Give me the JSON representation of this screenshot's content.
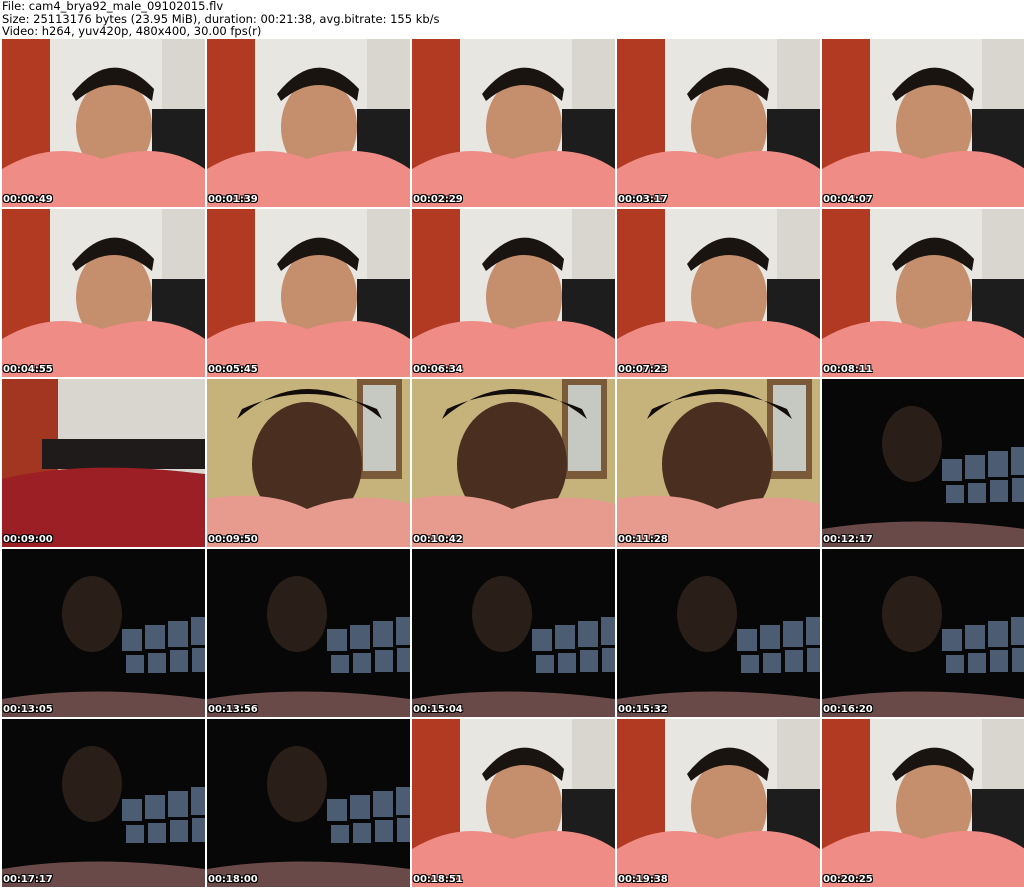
{
  "header": {
    "line1": "File: cam4_brya92_male_09102015.flv",
    "line2": "Size: 25113176 bytes (23.95 MiB), duration: 00:21:38, avg.bitrate: 155 kb/s",
    "line3": "Video: h264, yuv420p, 480x400, 30.00 fps(r)"
  },
  "thumbnails": [
    {
      "time": "00:00:49",
      "scene": "bright"
    },
    {
      "time": "00:01:39",
      "scene": "bright"
    },
    {
      "time": "00:02:29",
      "scene": "bright"
    },
    {
      "time": "00:03:17",
      "scene": "bright"
    },
    {
      "time": "00:04:07",
      "scene": "bright"
    },
    {
      "time": "00:04:55",
      "scene": "bright"
    },
    {
      "time": "00:05:45",
      "scene": "bright"
    },
    {
      "time": "00:06:34",
      "scene": "bright"
    },
    {
      "time": "00:07:23",
      "scene": "bright"
    },
    {
      "time": "00:08:11",
      "scene": "bright"
    },
    {
      "time": "00:09:00",
      "scene": "empty"
    },
    {
      "time": "00:09:50",
      "scene": "yellow"
    },
    {
      "time": "00:10:42",
      "scene": "yellow"
    },
    {
      "time": "00:11:28",
      "scene": "yellow"
    },
    {
      "time": "00:12:17",
      "scene": "dark"
    },
    {
      "time": "00:13:05",
      "scene": "dark"
    },
    {
      "time": "00:13:56",
      "scene": "dark"
    },
    {
      "time": "00:15:04",
      "scene": "dark"
    },
    {
      "time": "00:15:32",
      "scene": "dark"
    },
    {
      "time": "00:16:20",
      "scene": "dark"
    },
    {
      "time": "00:17:17",
      "scene": "dark"
    },
    {
      "time": "00:18:00",
      "scene": "dark"
    },
    {
      "time": "00:18:51",
      "scene": "bright"
    },
    {
      "time": "00:19:38",
      "scene": "bright"
    },
    {
      "time": "00:20:25",
      "scene": "bright"
    }
  ]
}
